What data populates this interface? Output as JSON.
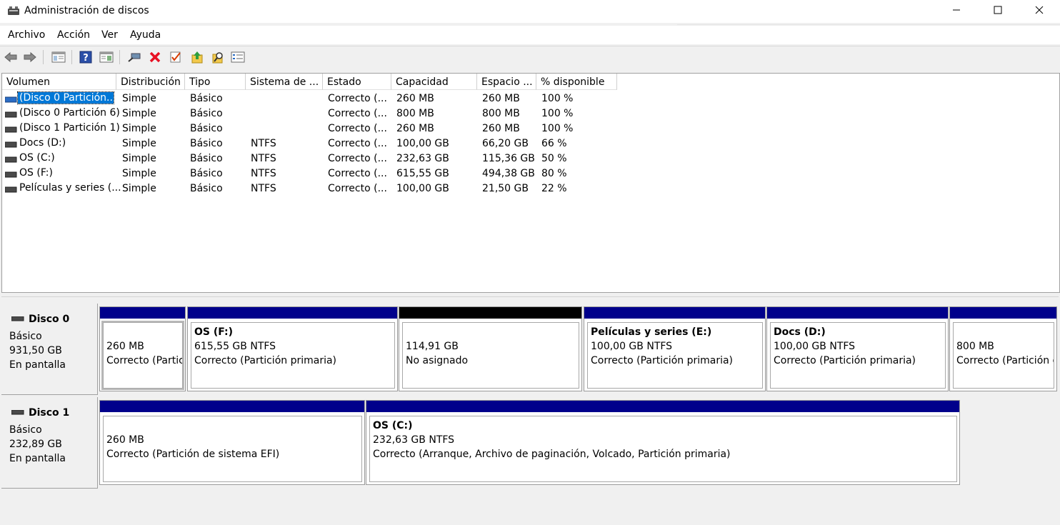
{
  "window": {
    "title": "Administración de discos"
  },
  "menu": {
    "items": [
      "Archivo",
      "Acción",
      "Ver",
      "Ayuda"
    ]
  },
  "toolbar": {
    "icons": [
      "back-icon",
      "forward-icon",
      "properties-pane-icon",
      "help-icon",
      "console-icon",
      "connect-icon",
      "delete-icon",
      "check-icon",
      "import-icon",
      "search-icon",
      "properties-icon"
    ],
    "delete_color": "#e81123"
  },
  "volume_list": {
    "columns": [
      "Volumen",
      "Distribución",
      "Tipo",
      "Sistema de ...",
      "Estado",
      "Capacidad",
      "Espacio ...",
      "% disponible"
    ],
    "rows": [
      {
        "volume": "(Disco 0 Partición...",
        "layout": "Simple",
        "type": "Básico",
        "fs": "",
        "status": "Correcto (...",
        "capacity": "260 MB",
        "free": "260 MB",
        "pct": "100 %"
      },
      {
        "volume": "(Disco 0 Partición 6)",
        "layout": "Simple",
        "type": "Básico",
        "fs": "",
        "status": "Correcto (...",
        "capacity": "800 MB",
        "free": "800 MB",
        "pct": "100 %"
      },
      {
        "volume": "(Disco 1 Partición 1)",
        "layout": "Simple",
        "type": "Básico",
        "fs": "",
        "status": "Correcto (...",
        "capacity": "260 MB",
        "free": "260 MB",
        "pct": "100 %"
      },
      {
        "volume": "Docs (D:)",
        "layout": "Simple",
        "type": "Básico",
        "fs": "NTFS",
        "status": "Correcto (...",
        "capacity": "100,00 GB",
        "free": "66,20 GB",
        "pct": "66 %"
      },
      {
        "volume": "OS (C:)",
        "layout": "Simple",
        "type": "Básico",
        "fs": "NTFS",
        "status": "Correcto (...",
        "capacity": "232,63 GB",
        "free": "115,36 GB",
        "pct": "50 %"
      },
      {
        "volume": "OS (F:)",
        "layout": "Simple",
        "type": "Básico",
        "fs": "NTFS",
        "status": "Correcto (...",
        "capacity": "615,55 GB",
        "free": "494,38 GB",
        "pct": "80 %"
      },
      {
        "volume": "Películas y series (...",
        "layout": "Simple",
        "type": "Básico",
        "fs": "NTFS",
        "status": "Correcto (...",
        "capacity": "100,00 GB",
        "free": "21,50 GB",
        "pct": "22 %"
      }
    ]
  },
  "disks": [
    {
      "name": "Disco 0",
      "type": "Básico",
      "size": "931,50 GB",
      "status": "En pantalla",
      "partitions": [
        {
          "title": "",
          "size": "260 MB",
          "status": "Correcto (Partic"
        },
        {
          "title": "OS  (F:)",
          "size": "615,55 GB NTFS",
          "status": "Correcto (Partición primaria)"
        },
        {
          "title": "",
          "size": "114,91 GB",
          "status": "No asignado"
        },
        {
          "title": "Películas y series  (E:)",
          "size": "100,00 GB NTFS",
          "status": "Correcto (Partición primaria)"
        },
        {
          "title": "Docs  (D:)",
          "size": "100,00 GB NTFS",
          "status": "Correcto (Partición primaria)"
        },
        {
          "title": "",
          "size": "800 MB",
          "status": "Correcto (Partición d"
        }
      ]
    },
    {
      "name": "Disco 1",
      "type": "Básico",
      "size": "232,89 GB",
      "status": "En pantalla",
      "partitions": [
        {
          "title": "",
          "size": "260 MB",
          "status": "Correcto (Partición de sistema EFI)"
        },
        {
          "title": "OS  (C:)",
          "size": "232,63 GB NTFS",
          "status": "Correcto (Arranque, Archivo de paginación, Volcado, Partición primaria)"
        }
      ]
    }
  ],
  "colors": {
    "primary_partition": "#00008b",
    "unallocated": "#000000",
    "selection": "#0078d7"
  }
}
